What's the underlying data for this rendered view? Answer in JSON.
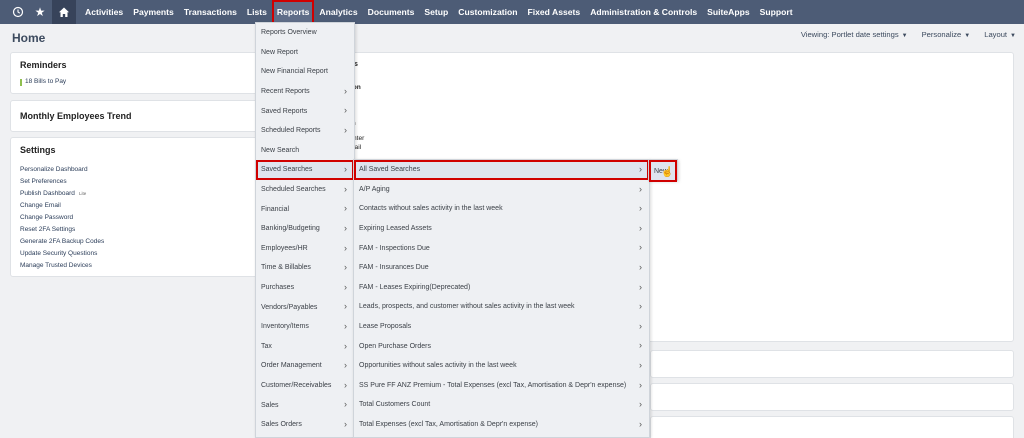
{
  "nav": {
    "items": [
      "Activities",
      "Payments",
      "Transactions",
      "Lists",
      "Reports",
      "Analytics",
      "Documents",
      "Setup",
      "Customization",
      "Fixed Assets",
      "Administration & Controls",
      "SuiteApps",
      "Support"
    ],
    "active": "Reports",
    "icons": [
      "recent-records-icon",
      "star-icon",
      "home-icon"
    ]
  },
  "page": {
    "title": "Home",
    "viewing": "Viewing: Portlet date settings",
    "personalize": "Personalize",
    "layout": "Layout"
  },
  "reminders": {
    "title": "Reminders",
    "items": [
      "18 Bills to Pay"
    ]
  },
  "trend": {
    "title": "Monthly Employees Trend"
  },
  "settings": {
    "title": "Settings",
    "links": [
      "Personalize Dashboard",
      "Set Preferences",
      "Publish Dashboard",
      "Change Email",
      "Change Password",
      "Reset 2FA Settings",
      "Generate 2FA Backup Codes",
      "Update Security Questions",
      "Manage Trusted Devices"
    ],
    "publish_badge": "Lite"
  },
  "partial_text": [
    "s",
    "ation",
    "tion",
    "nter",
    "t Trail"
  ],
  "reports_menu": [
    {
      "label": "Reports Overview",
      "arrow": false
    },
    {
      "label": "New Report",
      "arrow": false
    },
    {
      "label": "New Financial Report",
      "arrow": false
    },
    {
      "label": "Recent Reports",
      "arrow": true
    },
    {
      "label": "Saved Reports",
      "arrow": true
    },
    {
      "label": "Scheduled Reports",
      "arrow": true
    },
    {
      "label": "New Search",
      "arrow": false
    },
    {
      "label": "Saved Searches",
      "arrow": true,
      "highlight": true
    },
    {
      "label": "Scheduled Searches",
      "arrow": true
    },
    {
      "label": "Financial",
      "arrow": true
    },
    {
      "label": "Banking/Budgeting",
      "arrow": true
    },
    {
      "label": "Employees/HR",
      "arrow": true
    },
    {
      "label": "Time & Billables",
      "arrow": true
    },
    {
      "label": "Purchases",
      "arrow": true
    },
    {
      "label": "Vendors/Payables",
      "arrow": true
    },
    {
      "label": "Inventory/Items",
      "arrow": true
    },
    {
      "label": "Tax",
      "arrow": true
    },
    {
      "label": "Order Management",
      "arrow": true
    },
    {
      "label": "Customer/Receivables",
      "arrow": true
    },
    {
      "label": "Sales",
      "arrow": true
    },
    {
      "label": "Sales Orders",
      "arrow": true
    }
  ],
  "saved_menu": [
    {
      "label": "All Saved Searches",
      "highlight": true
    },
    {
      "label": "A/P Aging"
    },
    {
      "label": "Contacts without sales activity in the last week"
    },
    {
      "label": "Expiring Leased Assets"
    },
    {
      "label": "FAM - Inspections Due"
    },
    {
      "label": "FAM - Insurances Due"
    },
    {
      "label": "FAM - Leases Expiring(Deprecated)"
    },
    {
      "label": "Leads, prospects, and customer without sales activity in the last week"
    },
    {
      "label": "Lease Proposals"
    },
    {
      "label": "Open Purchase Orders"
    },
    {
      "label": "Opportunities without sales activity in the last week"
    },
    {
      "label": "SS Pure FF ANZ Premium - Total Expenses (excl Tax, Amortisation & Depr'n expense)"
    },
    {
      "label": "Total Customers Count"
    },
    {
      "label": "Total Expenses (excl Tax, Amortisation & Depr'n expense)"
    }
  ],
  "new_menu": {
    "label": "New"
  },
  "colors": {
    "nav_bg": "#4d5c76",
    "highlight": "#d00000"
  }
}
